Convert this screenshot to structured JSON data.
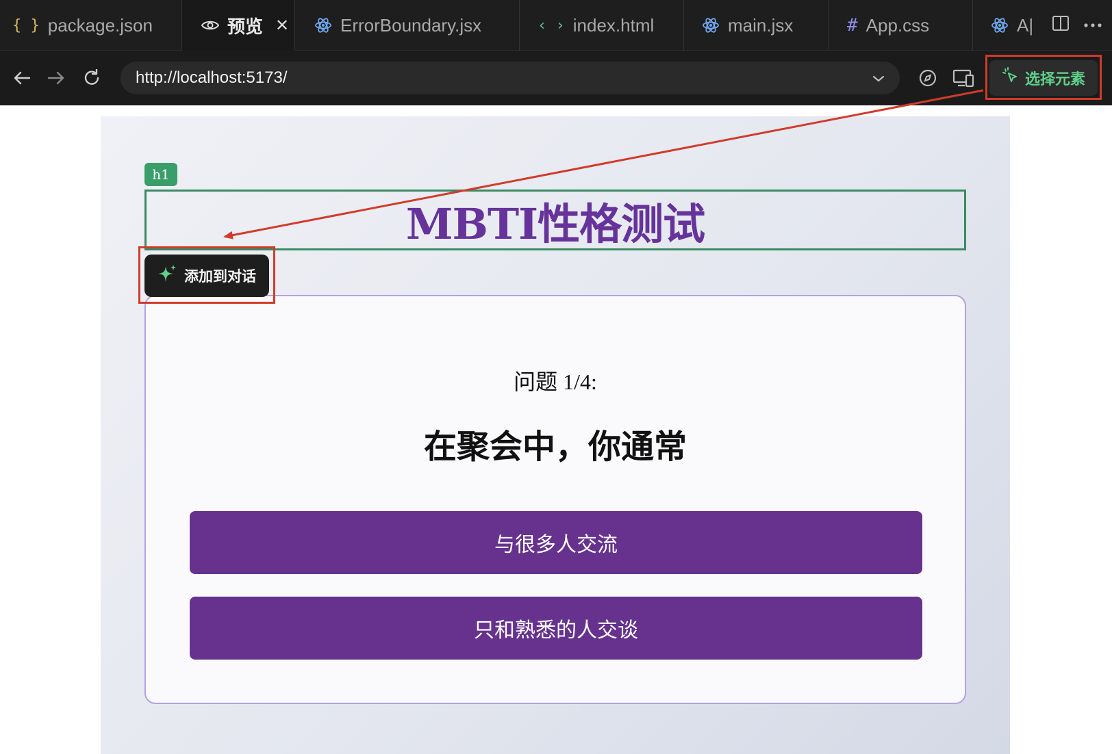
{
  "tabs": [
    {
      "icon": "json-braces-icon",
      "label": "package.json",
      "active": false
    },
    {
      "icon": "eye-icon",
      "label": "预览",
      "active": true
    },
    {
      "icon": "react-icon",
      "label": "ErrorBoundary.jsx",
      "active": false
    },
    {
      "icon": "html-code-icon",
      "label": "index.html",
      "active": false
    },
    {
      "icon": "react-icon",
      "label": "main.jsx",
      "active": false
    },
    {
      "icon": "hash-icon",
      "label": "App.css",
      "active": false
    },
    {
      "icon": "react-icon",
      "label": "A|",
      "active": false
    }
  ],
  "toolbar": {
    "url": "http://localhost:5173/",
    "select_element_label": "选择元素"
  },
  "preview": {
    "element_tag": "h1",
    "title": "MBTI性格测试",
    "add_to_chat_label": "添加到对话",
    "question_label": "问题 1/4:",
    "question_text": "在聚会中，你通常",
    "options": [
      "与很多人交流",
      "只和熟悉的人交谈"
    ]
  },
  "colors": {
    "accent_green": "#5fd08a",
    "annotation_red": "#d13b2b",
    "title_purple": "#66339a",
    "button_purple": "#66328d",
    "tag_green": "#3a9e6a"
  }
}
